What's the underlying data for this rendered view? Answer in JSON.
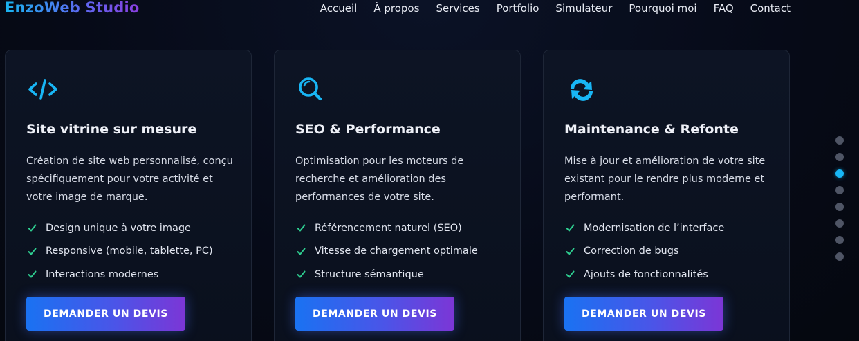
{
  "header": {
    "logo": "EnzoWeb Studio",
    "nav": [
      "Accueil",
      "À propos",
      "Services",
      "Portfolio",
      "Simulateur",
      "Pourquoi moi",
      "FAQ",
      "Contact"
    ]
  },
  "services": [
    {
      "icon": "code-icon",
      "title": "Site vitrine sur mesure",
      "description": "Création de site web personnalisé, conçu spécifiquement pour votre activité et votre image de marque.",
      "features": [
        "Design unique à votre image",
        "Responsive (mobile, tablette, PC)",
        "Interactions modernes"
      ],
      "button": "DEMANDER UN DEVIS"
    },
    {
      "icon": "search-icon",
      "title": "SEO & Performance",
      "description": "Optimisation pour les moteurs de recherche et amélioration des performances de votre site.",
      "features": [
        "Référencement naturel (SEO)",
        "Vitesse de chargement optimale",
        "Structure sémantique"
      ],
      "button": "DEMANDER UN DEVIS"
    },
    {
      "icon": "refresh-icon",
      "title": "Maintenance & Refonte",
      "description": "Mise à jour et amélioration de votre site existant pour le rendre plus moderne et performant.",
      "features": [
        "Modernisation de l’interface",
        "Correction de bugs",
        "Ajouts de fonctionnalités"
      ],
      "button": "DEMANDER UN DEVIS"
    }
  ],
  "section_dots": {
    "count": 8,
    "active_index": 2
  },
  "colors": {
    "accent": "#18b6f5",
    "check": "#2ecc8f",
    "button_start": "#1a72f2",
    "button_end": "#7c36d6"
  }
}
